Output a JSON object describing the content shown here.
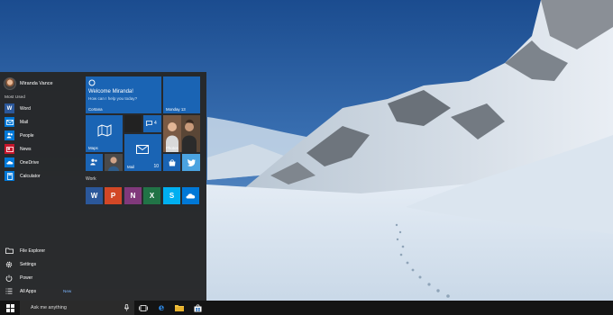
{
  "user": {
    "name": "Miranda Vance"
  },
  "start_menu": {
    "most_used_label": "Most Used",
    "most_used": [
      {
        "label": "Word",
        "icon": "word-icon",
        "color": "#2b579a",
        "glyph": "W"
      },
      {
        "label": "Mail",
        "icon": "mail-icon",
        "color": "#0078d7",
        "glyph": "✉"
      },
      {
        "label": "People",
        "icon": "people-icon",
        "color": "#0078d7",
        "glyph": "👥"
      },
      {
        "label": "News",
        "icon": "news-icon",
        "color": "#c7162b",
        "glyph": "▤"
      },
      {
        "label": "OneDrive",
        "icon": "onedrive-icon",
        "color": "#0078d7",
        "glyph": "☁"
      },
      {
        "label": "Calculator",
        "icon": "calculator-icon",
        "color": "#0078d7",
        "glyph": "▦"
      }
    ],
    "system": [
      {
        "label": "File Explorer",
        "icon": "folder-icon"
      },
      {
        "label": "Settings",
        "icon": "gear-icon"
      },
      {
        "label": "Power",
        "icon": "power-icon"
      },
      {
        "label": "All Apps",
        "icon": "list-icon",
        "badge": "New"
      }
    ]
  },
  "tiles": {
    "cortana": {
      "title": "Welcome Miranda!",
      "subtitle": "How can I help you today?",
      "label": "Cortana"
    },
    "calendar": {
      "label": "Monday 13"
    },
    "maps": {
      "label": "Maps"
    },
    "messaging": {
      "count": "4"
    },
    "photos": {
      "label": "Photos"
    },
    "mail": {
      "label": "Mail",
      "count": "10"
    },
    "work_label": "Work"
  },
  "work_tiles": [
    {
      "name": "word",
      "glyph": "W",
      "color": "#2b579a"
    },
    {
      "name": "powerpoint",
      "glyph": "P",
      "color": "#d24726"
    },
    {
      "name": "onenote",
      "glyph": "N",
      "color": "#80397b"
    },
    {
      "name": "excel",
      "glyph": "X",
      "color": "#217346"
    },
    {
      "name": "skype",
      "glyph": "S",
      "color": "#00aff0"
    },
    {
      "name": "onedrive",
      "glyph": "☁",
      "color": "#0078d7"
    }
  ],
  "taskbar": {
    "search_placeholder": "Ask me anything"
  },
  "colors": {
    "accent": "#1f6fc0",
    "tile_blue": "#1a64b4",
    "twitter": "#4ba3e0"
  }
}
